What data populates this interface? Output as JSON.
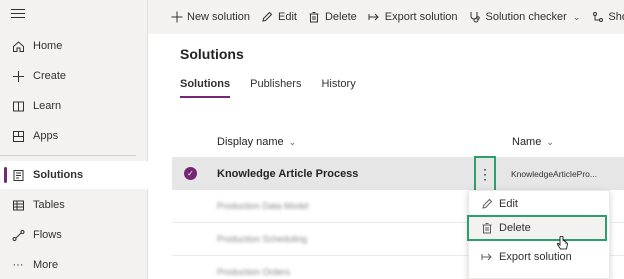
{
  "sidebar": {
    "items": [
      {
        "label": "Home",
        "icon": "home-icon"
      },
      {
        "label": "Create",
        "icon": "plus-icon"
      },
      {
        "label": "Learn",
        "icon": "book-icon"
      },
      {
        "label": "Apps",
        "icon": "apps-icon"
      },
      {
        "label": "Solutions",
        "icon": "solutions-icon",
        "active": true
      },
      {
        "label": "Tables",
        "icon": "table-icon"
      },
      {
        "label": "Flows",
        "icon": "flow-icon"
      },
      {
        "label": "More",
        "icon": "more-horizontal-icon"
      }
    ]
  },
  "commandbar": {
    "new_solution": "New solution",
    "edit": "Edit",
    "delete": "Delete",
    "export_solution": "Export solution",
    "solution_checker": "Solution checker",
    "show": "Sho"
  },
  "main": {
    "title": "Solutions",
    "tabs": [
      "Solutions",
      "Publishers",
      "History"
    ],
    "columns": {
      "display_name": "Display name",
      "name": "Name"
    },
    "selected_row": {
      "display_name": "Knowledge Article Process",
      "name": "KnowledgeArticlePro..."
    },
    "blurred_rows": [
      "Production Data Model",
      "Production Scheduling",
      "Production Orders"
    ]
  },
  "context_menu": {
    "edit": "Edit",
    "delete": "Delete",
    "export_solution": "Export solution"
  },
  "colors": {
    "accent": "#742774",
    "highlight_border": "#2e9e6b"
  }
}
